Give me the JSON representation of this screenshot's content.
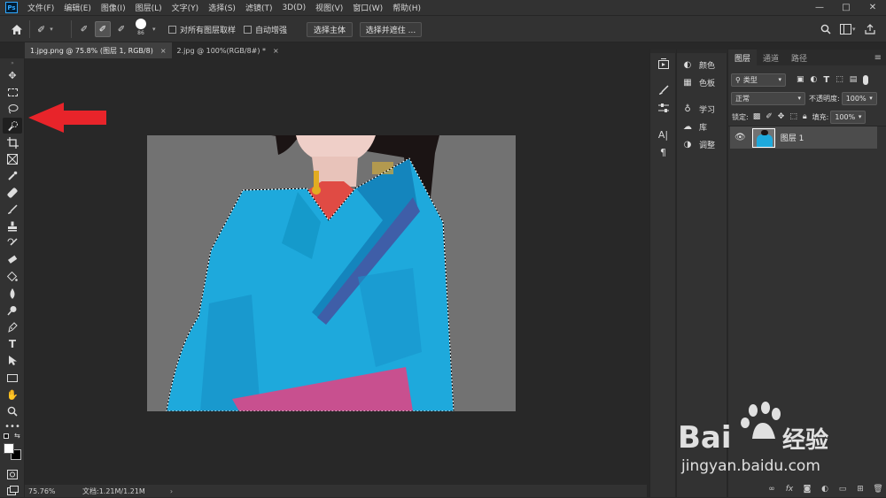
{
  "app": {
    "logo": "Ps",
    "menu": [
      "文件(F)",
      "编辑(E)",
      "图像(I)",
      "图层(L)",
      "文字(Y)",
      "选择(S)",
      "滤镜(T)",
      "3D(D)",
      "视图(V)",
      "窗口(W)",
      "帮助(H)"
    ],
    "window_controls": [
      "—",
      "□",
      "✕"
    ]
  },
  "options": {
    "brush_size": "86",
    "sample_all_layers": "对所有图层取样",
    "auto_enhance": "自动增强",
    "select_subject": "选择主体",
    "select_and_mask": "选择并遮住 ..."
  },
  "tabs": [
    {
      "label": "1.jpg.png @ 75.8% (图层 1, RGB/8)",
      "close": "×"
    },
    {
      "label": "2.jpg @ 100%(RGB/8#) *",
      "close": "×"
    }
  ],
  "status": {
    "zoom": "75.76%",
    "doc_size": "文档:1.21M/1.21M",
    "more": "›"
  },
  "mini_panel": {
    "items": [
      "颜色",
      "色板",
      "学习",
      "库",
      "调整"
    ]
  },
  "layers": {
    "tabs": [
      "图层",
      "通道",
      "路径"
    ],
    "filter_kind": "类型",
    "blend_mode": "正常",
    "opacity_label": "不透明度:",
    "opacity_value": "100%",
    "lock_label": "锁定:",
    "fill_label": "填充:",
    "fill_value": "100%",
    "layer_name": "图层 1"
  },
  "watermark": {
    "brand": "Bai",
    "brand_suffix": "经验",
    "url": "jingyan.baidu.com"
  },
  "colors": {
    "accent_red": "#e8242a",
    "robe_blue": "#1ea9dc"
  }
}
